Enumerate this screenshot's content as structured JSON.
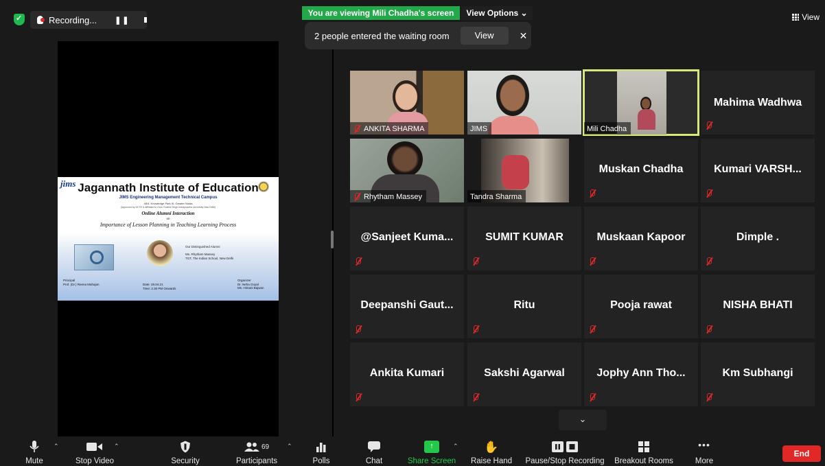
{
  "recording": {
    "label": "Recording..."
  },
  "banner": {
    "viewing": "You are viewing Mili Chadha's screen",
    "view_options": "View Options ⌄"
  },
  "waiting_room": {
    "message": "2 people entered the waiting room",
    "view_label": "View",
    "close_glyph": "✕"
  },
  "view_button": {
    "label": "View"
  },
  "slide": {
    "logo": "jims",
    "title": "Jagannath Institute of Education",
    "subtitle": "JIMS Engineering Management Technical Campus",
    "address": "48/4, Knowledge Park III, Greater Noida",
    "approval": "(Approved by NCTE & Affiliated to Guru Gobind Singh Indraprastha University New Delhi)",
    "event": "Online Alumni Interaction",
    "on": "on",
    "topic": "Importance of Lesson Planning in Teaching Learning Process",
    "alumni_heading": "Our Distinguished Alumni",
    "alumni_name": "Ms. Rhytham Massey",
    "alumni_role": "TGT, The Indian School, New Delhi",
    "principal_label": "Principal",
    "principal_name": "Prof. (Dr.) Reena Mahajan",
    "date": "Date: 28.04.21",
    "time": "Time: 2.30 PM Onwards",
    "organizer_label": "Organizer",
    "organizer_1": "Dr. Neha Goyal",
    "organizer_2": "Ms. Himani Bajwan"
  },
  "participants_grid": [
    {
      "name": "ANKITA SHARMA",
      "video": true
    },
    {
      "name": "JIMS",
      "video": true
    },
    {
      "name": "Mili Chadha",
      "video": true,
      "active_speaker": true
    },
    {
      "name": "Mahima Wadhwa",
      "video": false
    },
    {
      "name": "Rhytham Massey",
      "video": true
    },
    {
      "name": "Tandra Sharma",
      "video": true
    },
    {
      "name": "Muskan Chadha",
      "video": false
    },
    {
      "name": "Kumari  VARSH...",
      "video": false
    },
    {
      "name": "@Sanjeet  Kuma...",
      "video": false
    },
    {
      "name": "SUMIT KUMAR",
      "video": false
    },
    {
      "name": "Muskaan Kapoor",
      "video": false
    },
    {
      "name": "Dimple .",
      "video": false
    },
    {
      "name": "Deepanshi  Gaut...",
      "video": false
    },
    {
      "name": "Ritu",
      "video": false
    },
    {
      "name": "Pooja rawat",
      "video": false
    },
    {
      "name": "NISHA BHATI",
      "video": false
    },
    {
      "name": "Ankita Kumari",
      "video": false
    },
    {
      "name": "Sakshi Agarwal",
      "video": false
    },
    {
      "name": "Jophy Ann Tho...",
      "video": false
    },
    {
      "name": "Km Subhangi",
      "video": false
    }
  ],
  "toolbar": {
    "mute": "Mute",
    "stop_video": "Stop Video",
    "security": "Security",
    "participants": "Participants",
    "participants_count": "69",
    "polls": "Polls",
    "chat": "Chat",
    "share_screen": "Share Screen",
    "raise_hand": "Raise Hand",
    "pause_stop_recording": "Pause/Stop Recording",
    "breakout_rooms": "Breakout Rooms",
    "more": "More",
    "end": "End"
  },
  "colors": {
    "active_speaker_border": "#d9e87a",
    "share_green": "#23c84a",
    "end_red": "#e02828",
    "viewing_banner": "#23a84a"
  }
}
